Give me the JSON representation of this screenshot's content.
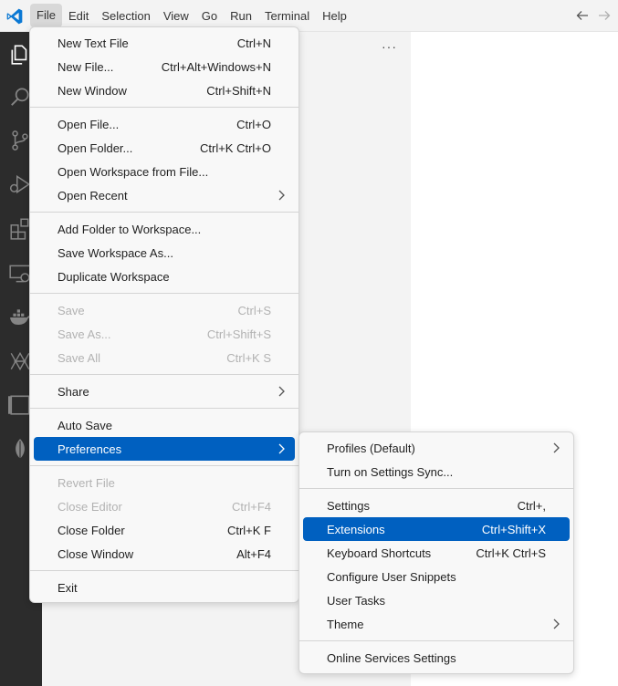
{
  "menubar": {
    "items": [
      "File",
      "Edit",
      "Selection",
      "View",
      "Go",
      "Run",
      "Terminal",
      "Help"
    ]
  },
  "icons": {
    "app": "vscode-logo-icon",
    "back": "arrow-left-icon",
    "forward": "arrow-right-icon",
    "activity": [
      "explorer-icon",
      "search-icon",
      "source-control-icon",
      "run-debug-icon",
      "extensions-icon",
      "remote-explorer-icon",
      "docker-icon",
      "kubernetes-icon",
      "terminal-panel-icon",
      "mongodb-leaf-icon"
    ]
  },
  "sidebar": {
    "more": "···"
  },
  "file_menu": {
    "groups": [
      [
        {
          "label": "New Text File",
          "kbd": "Ctrl+N"
        },
        {
          "label": "New File...",
          "kbd": "Ctrl+Alt+Windows+N"
        },
        {
          "label": "New Window",
          "kbd": "Ctrl+Shift+N"
        }
      ],
      [
        {
          "label": "Open File...",
          "kbd": "Ctrl+O"
        },
        {
          "label": "Open Folder...",
          "kbd": "Ctrl+K Ctrl+O"
        },
        {
          "label": "Open Workspace from File...",
          "kbd": ""
        },
        {
          "label": "Open Recent",
          "kbd": "",
          "submenu": true
        }
      ],
      [
        {
          "label": "Add Folder to Workspace...",
          "kbd": ""
        },
        {
          "label": "Save Workspace As...",
          "kbd": ""
        },
        {
          "label": "Duplicate Workspace",
          "kbd": ""
        }
      ],
      [
        {
          "label": "Save",
          "kbd": "Ctrl+S",
          "disabled": true
        },
        {
          "label": "Save As...",
          "kbd": "Ctrl+Shift+S",
          "disabled": true
        },
        {
          "label": "Save All",
          "kbd": "Ctrl+K S",
          "disabled": true
        }
      ],
      [
        {
          "label": "Share",
          "kbd": "",
          "submenu": true
        }
      ],
      [
        {
          "label": "Auto Save",
          "kbd": ""
        },
        {
          "label": "Preferences",
          "kbd": "",
          "submenu": true,
          "selected": true
        }
      ],
      [
        {
          "label": "Revert File",
          "kbd": "",
          "disabled": true
        },
        {
          "label": "Close Editor",
          "kbd": "Ctrl+F4",
          "disabled": true
        },
        {
          "label": "Close Folder",
          "kbd": "Ctrl+K F"
        },
        {
          "label": "Close Window",
          "kbd": "Alt+F4"
        }
      ],
      [
        {
          "label": "Exit",
          "kbd": ""
        }
      ]
    ]
  },
  "preferences_menu": {
    "groups": [
      [
        {
          "label": "Profiles (Default)",
          "kbd": "",
          "submenu": true
        },
        {
          "label": "Turn on Settings Sync...",
          "kbd": ""
        }
      ],
      [
        {
          "label": "Settings",
          "kbd": "Ctrl+,"
        },
        {
          "label": "Extensions",
          "kbd": "Ctrl+Shift+X",
          "selected": true
        },
        {
          "label": "Keyboard Shortcuts",
          "kbd": "Ctrl+K Ctrl+S"
        },
        {
          "label": "Configure User Snippets",
          "kbd": ""
        },
        {
          "label": "User Tasks",
          "kbd": ""
        },
        {
          "label": "Theme",
          "kbd": "",
          "submenu": true
        }
      ],
      [
        {
          "label": "Online Services Settings",
          "kbd": ""
        }
      ]
    ]
  }
}
